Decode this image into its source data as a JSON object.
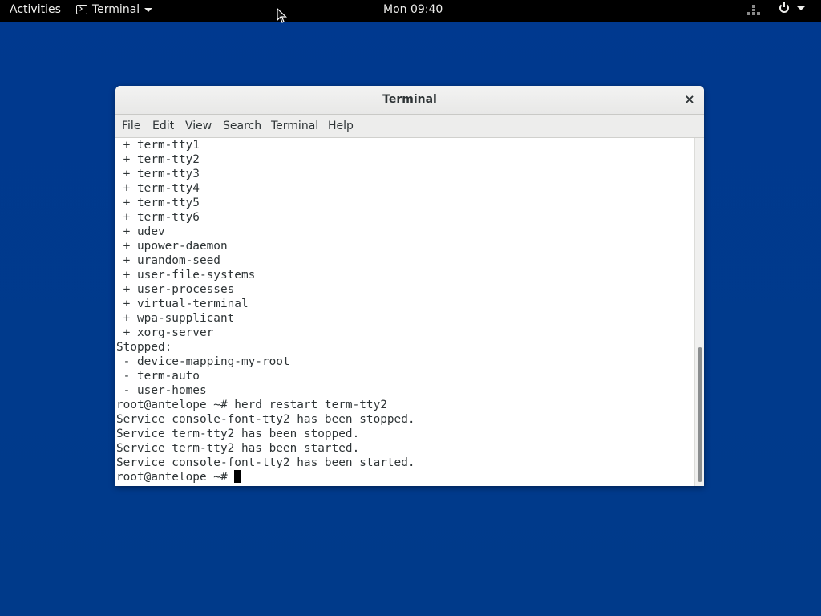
{
  "topbar": {
    "activities": "Activities",
    "app_name": "Terminal",
    "clock": "Mon 09:40"
  },
  "window": {
    "title": "Terminal",
    "close_glyph": "×",
    "menu": [
      "File",
      "Edit",
      "View",
      "Search",
      "Terminal",
      "Help"
    ]
  },
  "terminal": {
    "lines": [
      " + term-tty1",
      " + term-tty2",
      " + term-tty3",
      " + term-tty4",
      " + term-tty5",
      " + term-tty6",
      " + udev",
      " + upower-daemon",
      " + urandom-seed",
      " + user-file-systems",
      " + user-processes",
      " + virtual-terminal",
      " + wpa-supplicant",
      " + xorg-server",
      "Stopped:",
      " - device-mapping-my-root",
      " - term-auto",
      " - user-homes",
      "root@antelope ~# herd restart term-tty2",
      "Service console-font-tty2 has been stopped.",
      "Service term-tty2 has been stopped.",
      "Service term-tty2 has been started.",
      "Service console-font-tty2 has been started."
    ],
    "prompt": "root@antelope ~# "
  },
  "icons": {
    "app_menu": "terminal-icon",
    "network": "network-wired-icon",
    "power": "power-icon",
    "close": "close-icon"
  }
}
